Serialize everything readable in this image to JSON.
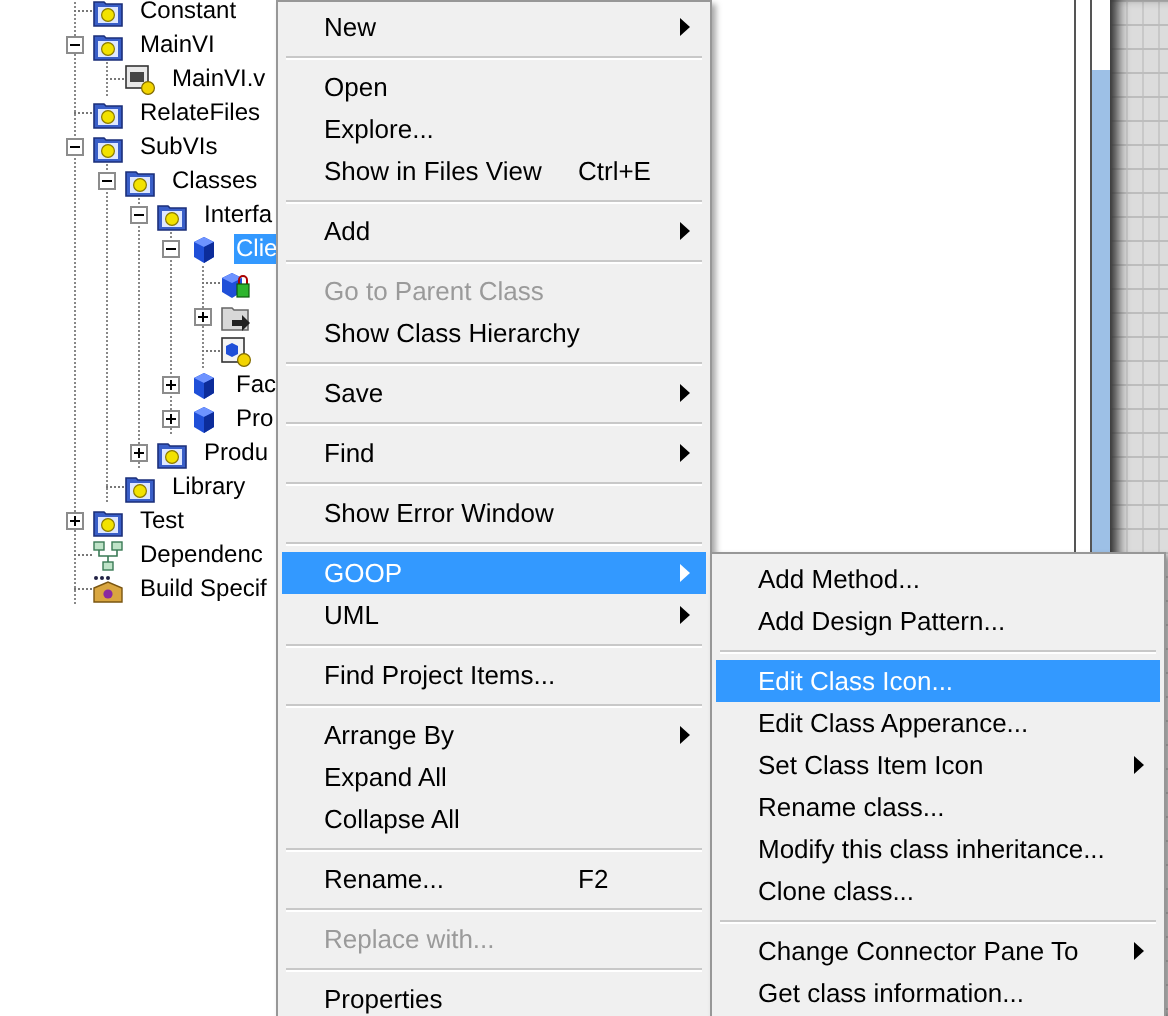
{
  "project_tree": {
    "items": [
      {
        "label": "Constant",
        "kind": "folder",
        "selected": false
      },
      {
        "label": "MainVI",
        "kind": "folder",
        "expanded": true,
        "selected": false,
        "children": [
          {
            "label": "MainVI.v",
            "kind": "vi",
            "selected": false
          }
        ]
      },
      {
        "label": "RelateFiles",
        "kind": "folder",
        "selected": false
      },
      {
        "label": "SubVIs",
        "kind": "folder",
        "expanded": true,
        "selected": false,
        "children": [
          {
            "label": "Classes",
            "kind": "folder",
            "expanded": true,
            "selected": false,
            "children": [
              {
                "label": "Interfa",
                "kind": "folder",
                "expanded": true,
                "selected": false,
                "children": [
                  {
                    "label": "Clie",
                    "kind": "class",
                    "expanded": true,
                    "selected": true,
                    "children": [
                      {
                        "kind": "class-data"
                      },
                      {
                        "kind": "property-folder",
                        "expanded": false
                      },
                      {
                        "kind": "member-vi"
                      }
                    ]
                  },
                  {
                    "label": "Fac",
                    "kind": "class",
                    "expanded": false,
                    "selected": false
                  },
                  {
                    "label": "Pro",
                    "kind": "class",
                    "expanded": false,
                    "selected": false
                  }
                ]
              },
              {
                "label": "Produ",
                "kind": "folder",
                "expanded": false,
                "selected": false
              }
            ]
          },
          {
            "label": "Library",
            "kind": "folder",
            "selected": false
          }
        ]
      },
      {
        "label": "Test",
        "kind": "folder",
        "expanded": false,
        "selected": false
      },
      {
        "label": "Dependenc",
        "kind": "dependencies",
        "selected": false
      },
      {
        "label": "Build Specif",
        "kind": "build",
        "selected": false
      }
    ]
  },
  "context_menu": {
    "items": [
      {
        "kind": "item",
        "label": "New",
        "submenu": true,
        "disabled": false,
        "selected": false
      },
      {
        "kind": "separator"
      },
      {
        "kind": "item",
        "label": "Open",
        "submenu": false,
        "disabled": false,
        "selected": false
      },
      {
        "kind": "item",
        "label": "Explore...",
        "submenu": false,
        "disabled": false,
        "selected": false
      },
      {
        "kind": "item",
        "label": "Show in Files View",
        "shortcut": "Ctrl+E",
        "submenu": false,
        "disabled": false,
        "selected": false
      },
      {
        "kind": "separator"
      },
      {
        "kind": "item",
        "label": "Add",
        "submenu": true,
        "disabled": false,
        "selected": false
      },
      {
        "kind": "separator"
      },
      {
        "kind": "item",
        "label": "Go to Parent Class",
        "submenu": false,
        "disabled": true,
        "selected": false
      },
      {
        "kind": "item",
        "label": "Show Class Hierarchy",
        "submenu": false,
        "disabled": false,
        "selected": false
      },
      {
        "kind": "separator"
      },
      {
        "kind": "item",
        "label": "Save",
        "submenu": true,
        "disabled": false,
        "selected": false
      },
      {
        "kind": "separator"
      },
      {
        "kind": "item",
        "label": "Find",
        "submenu": true,
        "disabled": false,
        "selected": false
      },
      {
        "kind": "separator"
      },
      {
        "kind": "item",
        "label": "Show Error Window",
        "submenu": false,
        "disabled": false,
        "selected": false
      },
      {
        "kind": "separator"
      },
      {
        "kind": "item",
        "label": "GOOP",
        "submenu": true,
        "disabled": false,
        "selected": true
      },
      {
        "kind": "item",
        "label": "UML",
        "submenu": true,
        "disabled": false,
        "selected": false
      },
      {
        "kind": "separator"
      },
      {
        "kind": "item",
        "label": "Find Project Items...",
        "submenu": false,
        "disabled": false,
        "selected": false
      },
      {
        "kind": "separator"
      },
      {
        "kind": "item",
        "label": "Arrange By",
        "submenu": true,
        "disabled": false,
        "selected": false
      },
      {
        "kind": "item",
        "label": "Expand All",
        "submenu": false,
        "disabled": false,
        "selected": false
      },
      {
        "kind": "item",
        "label": "Collapse All",
        "submenu": false,
        "disabled": false,
        "selected": false
      },
      {
        "kind": "separator"
      },
      {
        "kind": "item",
        "label": "Rename...",
        "shortcut": "F2",
        "submenu": false,
        "disabled": false,
        "selected": false
      },
      {
        "kind": "separator"
      },
      {
        "kind": "item",
        "label": "Replace with...",
        "submenu": false,
        "disabled": true,
        "selected": false
      },
      {
        "kind": "separator"
      },
      {
        "kind": "item",
        "label": "Properties",
        "submenu": false,
        "disabled": false,
        "selected": false
      }
    ]
  },
  "goop_submenu": {
    "items": [
      {
        "kind": "item",
        "label": "Add Method...",
        "submenu": false,
        "disabled": false,
        "selected": false
      },
      {
        "kind": "item",
        "label": "Add Design Pattern...",
        "submenu": false,
        "disabled": false,
        "selected": false
      },
      {
        "kind": "separator"
      },
      {
        "kind": "item",
        "label": "Edit Class Icon...",
        "submenu": false,
        "disabled": false,
        "selected": true
      },
      {
        "kind": "item",
        "label": "Edit Class Apperance...",
        "submenu": false,
        "disabled": false,
        "selected": false
      },
      {
        "kind": "item",
        "label": "Set Class Item Icon",
        "submenu": true,
        "disabled": false,
        "selected": false
      },
      {
        "kind": "item",
        "label": "Rename class...",
        "submenu": false,
        "disabled": false,
        "selected": false
      },
      {
        "kind": "item",
        "label": "Modify this class inheritance...",
        "submenu": false,
        "disabled": false,
        "selected": false
      },
      {
        "kind": "item",
        "label": "Clone class...",
        "submenu": false,
        "disabled": false,
        "selected": false
      },
      {
        "kind": "separator"
      },
      {
        "kind": "item",
        "label": "Change Connector Pane To",
        "submenu": true,
        "disabled": false,
        "selected": false
      },
      {
        "kind": "item",
        "label": "Get class information...",
        "submenu": false,
        "disabled": false,
        "selected": false
      }
    ]
  }
}
